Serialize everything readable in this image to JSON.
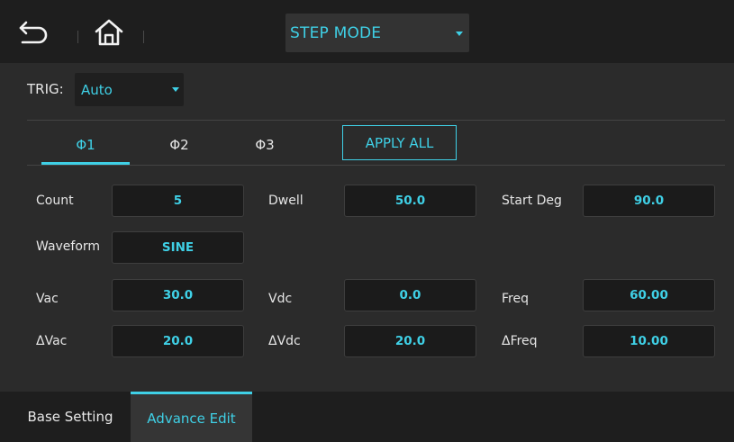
{
  "topbar": {
    "mode_select": {
      "value": "STEP MODE"
    }
  },
  "trig": {
    "label": "TRIG:",
    "value": "Auto"
  },
  "phase_tabs": [
    {
      "label": "Φ1",
      "active": true
    },
    {
      "label": "Φ2",
      "active": false
    },
    {
      "label": "Φ3",
      "active": false
    }
  ],
  "apply_all_label": "APPLY ALL",
  "fields": {
    "count": {
      "label": "Count",
      "value": "5"
    },
    "dwell": {
      "label": "Dwell",
      "value": "50.0"
    },
    "start_deg": {
      "label": "Start Deg",
      "value": "90.0"
    },
    "waveform": {
      "label": "Waveform",
      "value": "SINE"
    },
    "vac": {
      "label": "Vac",
      "value": "30.0"
    },
    "vdc": {
      "label": "Vdc",
      "value": "0.0"
    },
    "freq": {
      "label": "Freq",
      "value": "60.00"
    },
    "dvac": {
      "label": "ΔVac",
      "value": "20.0"
    },
    "dvdc": {
      "label": "ΔVdc",
      "value": "20.0"
    },
    "dfreq": {
      "label": "ΔFreq",
      "value": "10.00"
    }
  },
  "bottom_tabs": {
    "base": "Base Setting",
    "advance": "Advance Edit",
    "active": "advance"
  },
  "colors": {
    "accent": "#3fd0e6",
    "background": "#2b2b2b",
    "bar": "#1e1e1e"
  },
  "icons": [
    "back-icon",
    "home-icon",
    "dropdown-caret-icon"
  ]
}
